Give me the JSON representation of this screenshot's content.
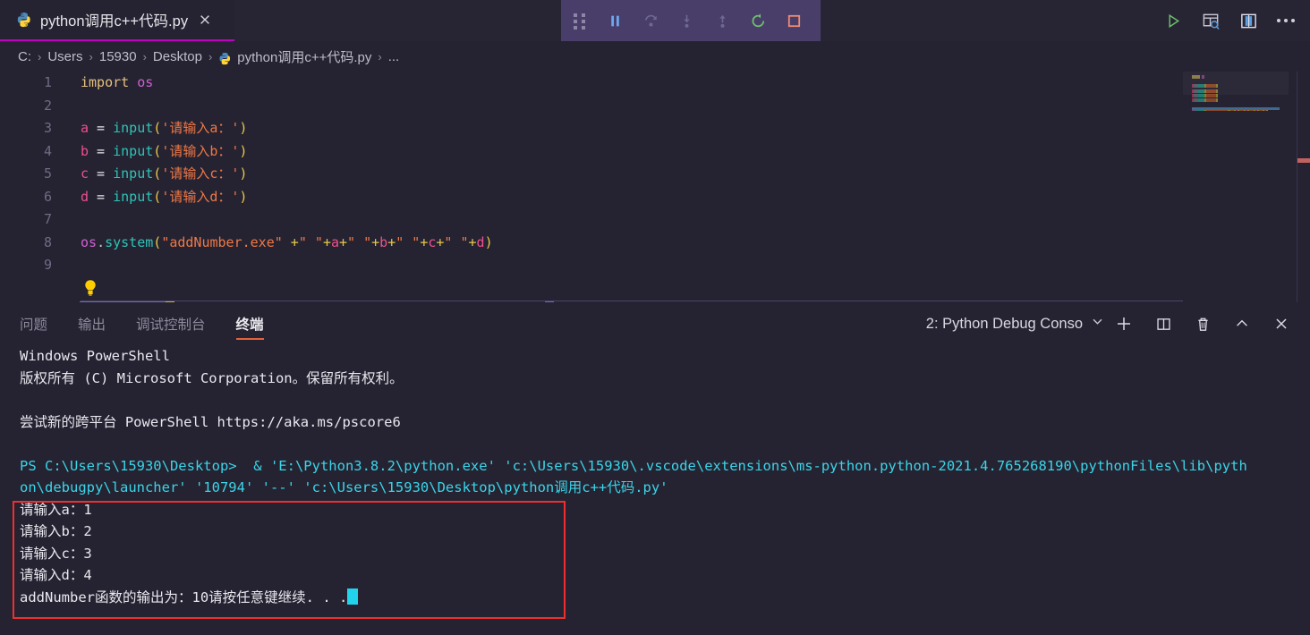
{
  "window": {
    "tab": {
      "label": "python调用c++代码.py",
      "icon": "python-icon",
      "close_icon": "close-icon"
    }
  },
  "debug_toolbar": {
    "items": [
      {
        "name": "drag-handle",
        "icon": "grip-dots-icon",
        "label": ""
      },
      {
        "name": "pause",
        "icon": "pause-icon",
        "label": ""
      },
      {
        "name": "step-over",
        "icon": "step-over-icon",
        "label": ""
      },
      {
        "name": "step-into",
        "icon": "step-into-icon",
        "label": ""
      },
      {
        "name": "step-out",
        "icon": "step-out-icon",
        "label": ""
      },
      {
        "name": "restart",
        "icon": "restart-icon",
        "label": ""
      },
      {
        "name": "stop",
        "icon": "stop-square-icon",
        "label": ""
      }
    ],
    "colors": {
      "background": "#493e69",
      "restart": "#6ec06e",
      "stop": "#f08a72",
      "pause": "#6aa9f0"
    }
  },
  "editor_actions": [
    {
      "name": "run-python-file",
      "icon": "play-icon",
      "color": "#6ec06e"
    },
    {
      "name": "open-preview-to-side",
      "icon": "preview-search-icon",
      "color": "#c8c6d2"
    },
    {
      "name": "split-editor",
      "icon": "split-editor-icon",
      "color": "#e0e0ea"
    },
    {
      "name": "more-actions",
      "icon": "ellipsis-icon",
      "color": "#d0d0d6"
    }
  ],
  "breadcrumb": {
    "items": [
      "C:",
      "Users",
      "15930",
      "Desktop",
      "python调用c++代码.py",
      "..."
    ],
    "separator": "›",
    "file_icon": "python-icon"
  },
  "code": {
    "lines": [
      {
        "no": "1",
        "tokens": [
          {
            "t": "import",
            "c": "k-import"
          },
          {
            "t": " ",
            "c": "k-op"
          },
          {
            "t": "os",
            "c": "k-mod"
          }
        ]
      },
      {
        "no": "2",
        "tokens": []
      },
      {
        "no": "3",
        "tokens": [
          {
            "t": "a",
            "c": "k-var"
          },
          {
            "t": " = ",
            "c": "k-op"
          },
          {
            "t": "input",
            "c": "k-fn"
          },
          {
            "t": "(",
            "c": "k-paren"
          },
          {
            "t": "'请输入a：'",
            "c": "k-str"
          },
          {
            "t": ")",
            "c": "k-paren"
          }
        ]
      },
      {
        "no": "4",
        "tokens": [
          {
            "t": "b",
            "c": "k-var"
          },
          {
            "t": " = ",
            "c": "k-op"
          },
          {
            "t": "input",
            "c": "k-fn"
          },
          {
            "t": "(",
            "c": "k-paren"
          },
          {
            "t": "'请输入b：'",
            "c": "k-str"
          },
          {
            "t": ")",
            "c": "k-paren"
          }
        ]
      },
      {
        "no": "5",
        "tokens": [
          {
            "t": "c",
            "c": "k-var"
          },
          {
            "t": " = ",
            "c": "k-op"
          },
          {
            "t": "input",
            "c": "k-fn"
          },
          {
            "t": "(",
            "c": "k-paren"
          },
          {
            "t": "'请输入c：'",
            "c": "k-str"
          },
          {
            "t": ")",
            "c": "k-paren"
          }
        ]
      },
      {
        "no": "6",
        "tokens": [
          {
            "t": "d",
            "c": "k-var"
          },
          {
            "t": " = ",
            "c": "k-op"
          },
          {
            "t": "input",
            "c": "k-fn"
          },
          {
            "t": "(",
            "c": "k-paren"
          },
          {
            "t": "'请输入d：'",
            "c": "k-str"
          },
          {
            "t": ")",
            "c": "k-paren"
          }
        ]
      },
      {
        "no": "7",
        "tokens": []
      },
      {
        "no": "8",
        "tokens": [
          {
            "t": "os",
            "c": "k-obj"
          },
          {
            "t": ".",
            "c": "k-dot"
          },
          {
            "t": "system",
            "c": "k-fn"
          },
          {
            "t": "(",
            "c": "k-paren"
          },
          {
            "t": "\"addNumber.exe\"",
            "c": "k-str"
          },
          {
            "t": " +",
            "c": "k-paren"
          },
          {
            "t": "\" \"",
            "c": "k-str"
          },
          {
            "t": "+",
            "c": "k-paren"
          },
          {
            "t": "a",
            "c": "k-var"
          },
          {
            "t": "+",
            "c": "k-paren"
          },
          {
            "t": "\" \"",
            "c": "k-str"
          },
          {
            "t": "+",
            "c": "k-paren"
          },
          {
            "t": "b",
            "c": "k-var"
          },
          {
            "t": "+",
            "c": "k-paren"
          },
          {
            "t": "\" \"",
            "c": "k-str"
          },
          {
            "t": "+",
            "c": "k-paren"
          },
          {
            "t": "c",
            "c": "k-var"
          },
          {
            "t": "+",
            "c": "k-paren"
          },
          {
            "t": "\" \"",
            "c": "k-str"
          },
          {
            "t": "+",
            "c": "k-paren"
          },
          {
            "t": "d",
            "c": "k-var"
          },
          {
            "t": ")",
            "c": "k-paren"
          }
        ]
      },
      {
        "no": "9",
        "tokens": []
      }
    ],
    "lightbulb_icon": "lightbulb-icon",
    "lightbulb_line": "7"
  },
  "panel": {
    "tabs": [
      {
        "label": "问题",
        "active": false
      },
      {
        "label": "输出",
        "active": false
      },
      {
        "label": "调试控制台",
        "active": false
      },
      {
        "label": "终端",
        "active": true
      }
    ],
    "terminal_select": {
      "value": "2: Python Debug Conso",
      "chevron": "chevron-down-icon"
    },
    "actions": [
      {
        "name": "new-terminal",
        "icon": "plus-icon"
      },
      {
        "name": "split-terminal",
        "icon": "split-icon"
      },
      {
        "name": "kill-terminal",
        "icon": "trash-icon"
      },
      {
        "name": "maximize-panel",
        "icon": "chevron-up-icon"
      },
      {
        "name": "close-panel",
        "icon": "close-icon"
      }
    ]
  },
  "terminal": {
    "lines": [
      {
        "text": "Windows PowerShell",
        "color": "default"
      },
      {
        "text": "版权所有 (C) Microsoft Corporation。保留所有权利。",
        "color": "default"
      },
      {
        "text": "",
        "color": "default"
      },
      {
        "text": "尝试新的跨平台 PowerShell https://aka.ms/pscore6",
        "color": "default"
      },
      {
        "text": "",
        "color": "default"
      },
      {
        "text": "PS C:\\Users\\15930\\Desktop>  & 'E:\\Python3.8.2\\python.exe' 'c:\\Users\\15930\\.vscode\\extensions\\ms-python.python-2021.4.765268190\\pythonFiles\\lib\\python\\debugpy\\launcher' '10794' '--' 'c:\\Users\\15930\\Desktop\\python调用c++代码.py'",
        "color": "cyan"
      },
      {
        "text": "请输入a：1",
        "color": "default"
      },
      {
        "text": "请输入b：2",
        "color": "default"
      },
      {
        "text": "请输入c：3",
        "color": "default"
      },
      {
        "text": "请输入d：4",
        "color": "default"
      },
      {
        "text": "addNumber函数的输出为：10请按任意键继续. . .",
        "color": "default",
        "cursor": true
      }
    ],
    "cursor_color": "#22d3ee"
  },
  "annotation": {
    "name": "red-highlight-box",
    "color": "#ef2f2f"
  }
}
